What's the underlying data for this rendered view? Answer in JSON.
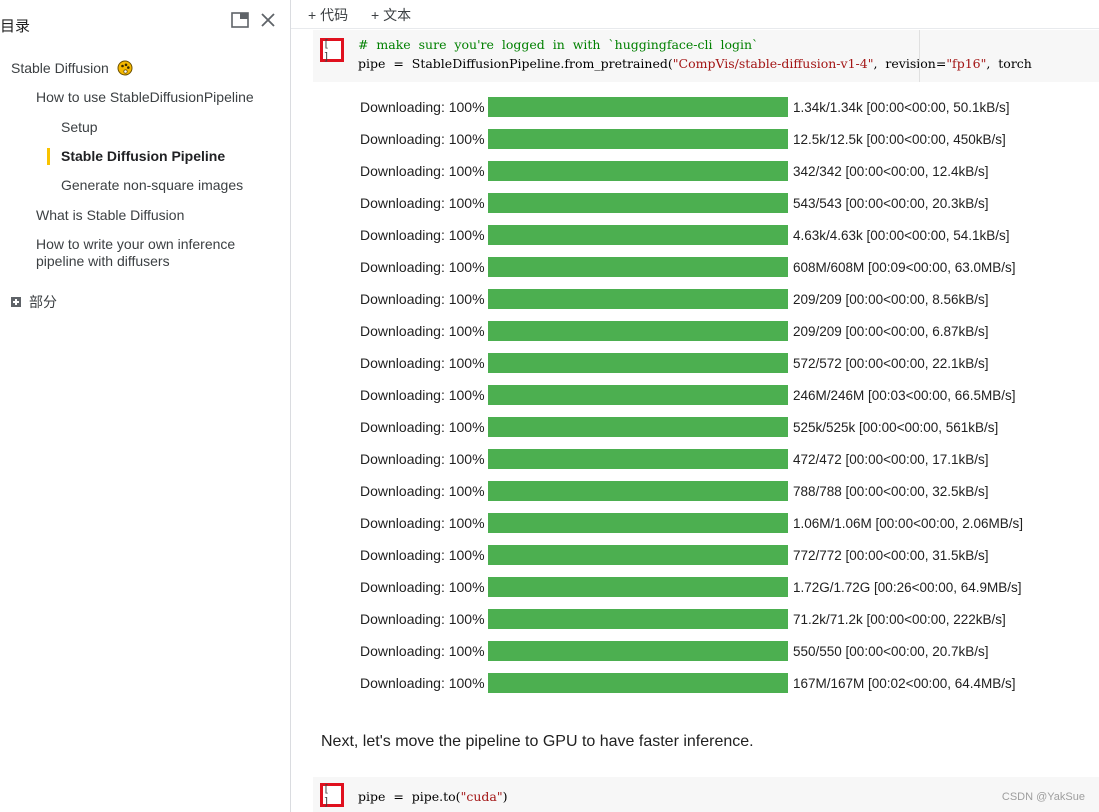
{
  "toc": {
    "title": "目录",
    "items": [
      {
        "label": "Stable Diffusion"
      },
      {
        "label": "How to use StableDiffusionPipeline"
      },
      {
        "label": "Setup"
      },
      {
        "label": "Stable Diffusion Pipeline"
      },
      {
        "label": "Generate non-square images"
      },
      {
        "label": "What is Stable Diffusion"
      },
      {
        "label": "How to write your own inference"
      },
      {
        "label": "pipeline with diffusers"
      }
    ],
    "section_label": "部分",
    "active_color": "#f9c300"
  },
  "toolbar": {
    "add_code": "+ 代码",
    "add_text": "+ 文本"
  },
  "cell1": {
    "run_label": "[ ]",
    "comment": "#  make  sure  you're  logged  in  with  `huggingface-cli  login`",
    "line2_prefix": "pipe  =  StableDiffusionPipeline.from_pretrained(",
    "line2_str1": "\"CompVis/stable-diffusion-v1-4\"",
    "line2_mid": ",  revision=",
    "line2_str2": "\"fp16\"",
    "line2_suffix": ",  torch"
  },
  "downloads": [
    {
      "label": "Downloading: 100%",
      "progress": 1.0,
      "info": "1.34k/1.34k [00:00<00:00, 50.1kB/s]"
    },
    {
      "label": "Downloading: 100%",
      "progress": 1.0,
      "info": "12.5k/12.5k [00:00<00:00, 450kB/s]"
    },
    {
      "label": "Downloading: 100%",
      "progress": 1.0,
      "info": "342/342 [00:00<00:00, 12.4kB/s]"
    },
    {
      "label": "Downloading: 100%",
      "progress": 1.0,
      "info": "543/543 [00:00<00:00, 20.3kB/s]"
    },
    {
      "label": "Downloading: 100%",
      "progress": 1.0,
      "info": "4.63k/4.63k [00:00<00:00, 54.1kB/s]"
    },
    {
      "label": "Downloading: 100%",
      "progress": 1.0,
      "info": "608M/608M [00:09<00:00, 63.0MB/s]"
    },
    {
      "label": "Downloading: 100%",
      "progress": 1.0,
      "info": "209/209 [00:00<00:00, 8.56kB/s]"
    },
    {
      "label": "Downloading: 100%",
      "progress": 1.0,
      "info": "209/209 [00:00<00:00, 6.87kB/s]"
    },
    {
      "label": "Downloading: 100%",
      "progress": 1.0,
      "info": "572/572 [00:00<00:00, 22.1kB/s]"
    },
    {
      "label": "Downloading: 100%",
      "progress": 1.0,
      "info": "246M/246M [00:03<00:00, 66.5MB/s]"
    },
    {
      "label": "Downloading: 100%",
      "progress": 1.0,
      "info": "525k/525k [00:00<00:00, 561kB/s]"
    },
    {
      "label": "Downloading: 100%",
      "progress": 1.0,
      "info": "472/472 [00:00<00:00, 17.1kB/s]"
    },
    {
      "label": "Downloading: 100%",
      "progress": 1.0,
      "info": "788/788 [00:00<00:00, 32.5kB/s]"
    },
    {
      "label": "Downloading: 100%",
      "progress": 1.0,
      "info": "1.06M/1.06M [00:00<00:00, 2.06MB/s]"
    },
    {
      "label": "Downloading: 100%",
      "progress": 1.0,
      "info": "772/772 [00:00<00:00, 31.5kB/s]"
    },
    {
      "label": "Downloading: 100%",
      "progress": 1.0,
      "info": "1.72G/1.72G [00:26<00:00, 64.9MB/s]"
    },
    {
      "label": "Downloading: 100%",
      "progress": 1.0,
      "info": "71.2k/71.2k [00:00<00:00, 222kB/s]"
    },
    {
      "label": "Downloading: 100%",
      "progress": 1.0,
      "info": "550/550 [00:00<00:00, 20.7kB/s]"
    },
    {
      "label": "Downloading: 100%",
      "progress": 1.0,
      "info": "167M/167M [00:02<00:00, 64.4MB/s]"
    }
  ],
  "progress_color": "#4caf50",
  "markdown": {
    "text": "Next, let's move the pipeline to GPU to have faster inference."
  },
  "cell2": {
    "run_label": "[ ]",
    "code_prefix": "pipe  =  pipe.to(",
    "code_str": "\"cuda\"",
    "code_suffix": ")"
  },
  "watermark": "CSDN @YakSue"
}
